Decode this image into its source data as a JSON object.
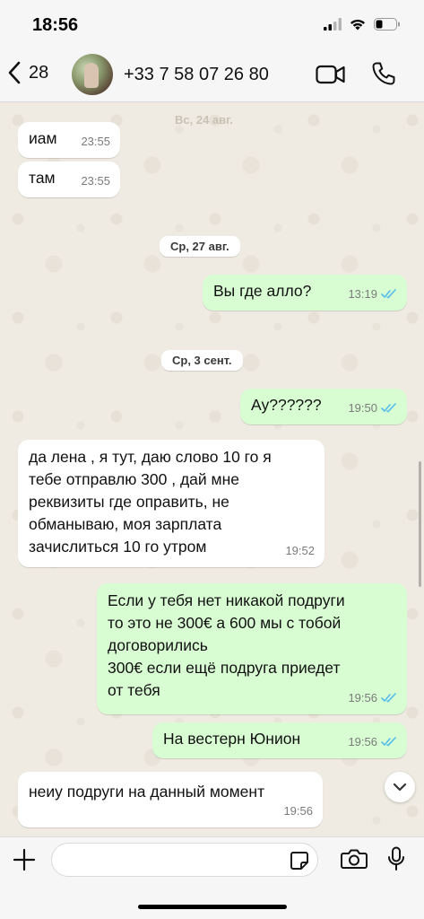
{
  "status_bar": {
    "time": "18:56"
  },
  "header": {
    "back_count": "28",
    "contact": "+33 7 58 07 26 80"
  },
  "chat": {
    "faint_date": "Вс, 24 авг.",
    "date_1": "Ср, 27 авг.",
    "date_2": "Ср, 3 сент.",
    "messages": [
      {
        "direction": "incoming",
        "text": "иам",
        "time": "23:55"
      },
      {
        "direction": "incoming",
        "text": "там",
        "time": "23:55"
      },
      {
        "direction": "outgoing",
        "text": "Вы где алло?",
        "time": "13:19",
        "status": "read"
      },
      {
        "direction": "outgoing",
        "text": "Ау??????",
        "time": "19:50",
        "status": "read"
      },
      {
        "direction": "incoming",
        "text": "да лена , я тут, даю слово 10 го я\nтебе отправлю 300 , дай мне\nреквизиты где оправить, не\nобманываю, моя зарплата\nзачислиться 10 го утром",
        "time": "19:52"
      },
      {
        "direction": "outgoing",
        "text": "Если у тебя нет никакой подруги\nто это не 300€ а 600 мы с тобой\nдоговорились\n300€ если ещё подруга приедет\nот тебя",
        "time": "19:56",
        "status": "read"
      },
      {
        "direction": "outgoing",
        "text": "На вестерн Юнион",
        "time": "19:56",
        "status": "read"
      },
      {
        "direction": "incoming",
        "text": "неиу подруги на данный момент",
        "time": "19:56"
      }
    ]
  },
  "composer": {
    "placeholder": ""
  },
  "colors": {
    "incoming_bubble": "#ffffff",
    "outgoing_bubble": "#d9fdd3",
    "read_ticks": "#53bdeb",
    "wallpaper": "#efeae2"
  },
  "icons": [
    "back-chevron-icon",
    "video-call-icon",
    "phone-icon",
    "plus-icon",
    "sticker-icon",
    "camera-icon",
    "microphone-icon",
    "chevron-down-icon",
    "signal-icon",
    "wifi-icon",
    "battery-icon"
  ]
}
